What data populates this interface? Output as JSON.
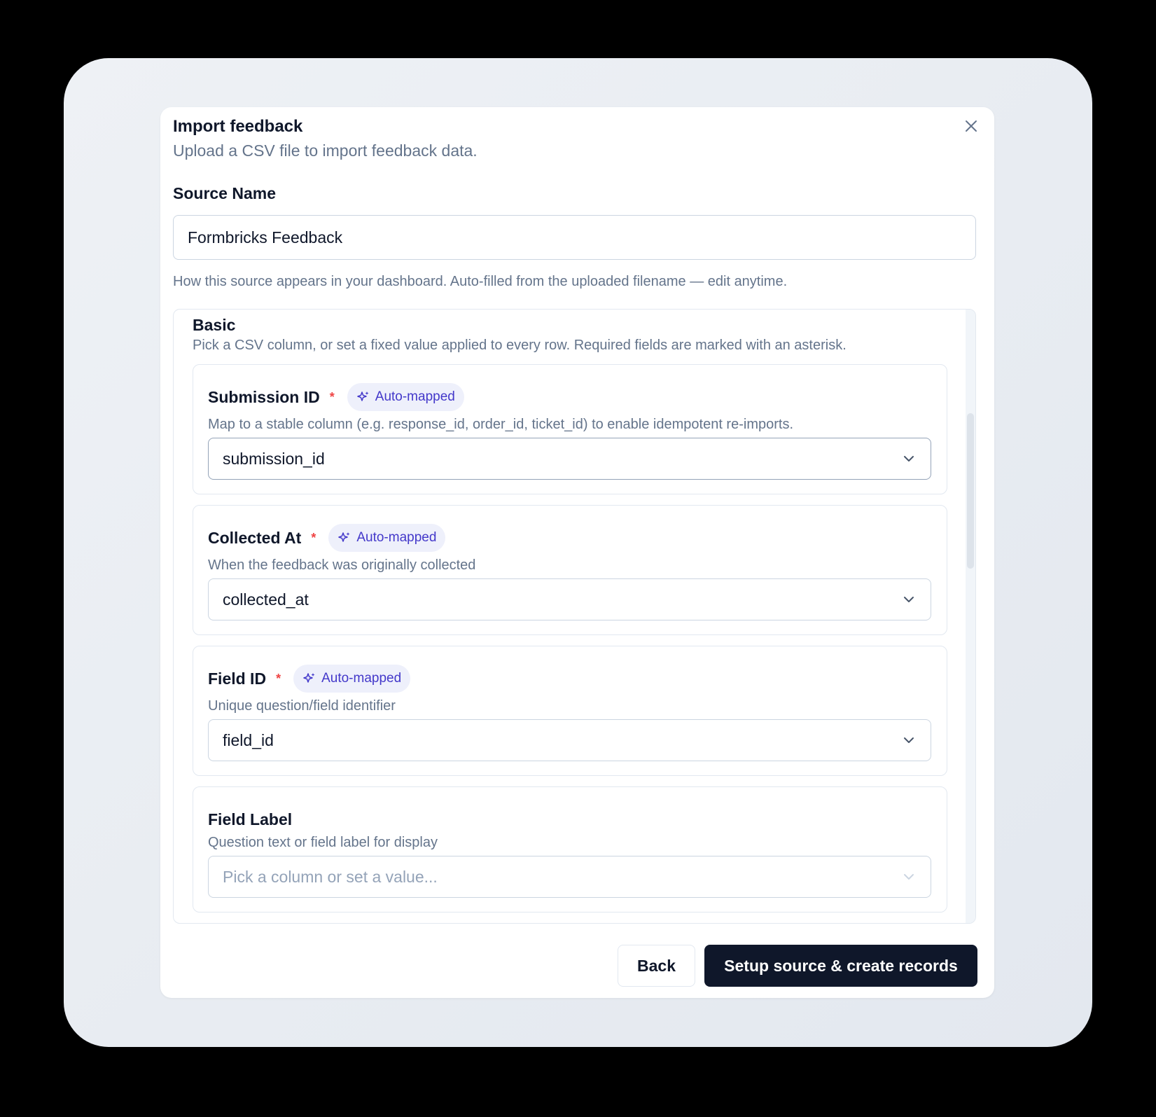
{
  "dialog": {
    "title": "Import feedback",
    "subtitle": "Upload a CSV file to import feedback data."
  },
  "source": {
    "label": "Source Name",
    "value": "Formbricks Feedback",
    "help": "How this source appears in your dashboard. Auto-filled from the uploaded filename — edit anytime."
  },
  "basic": {
    "title": "Basic",
    "description": "Pick a CSV column, or set a fixed value applied to every row. Required fields are marked with an asterisk.",
    "fields": [
      {
        "title": "Submission ID",
        "required_marker": "*",
        "badge": "Auto-mapped",
        "description": "Map to a stable column (e.g. response_id, order_id, ticket_id) to enable idempotent re-imports.",
        "value": "submission_id"
      },
      {
        "title": "Collected At",
        "required_marker": "*",
        "badge": "Auto-mapped",
        "description": "When the feedback was originally collected",
        "value": "collected_at"
      },
      {
        "title": "Field ID",
        "required_marker": "*",
        "badge": "Auto-mapped",
        "description": "Unique question/field identifier",
        "value": "field_id"
      },
      {
        "title": "Field Label",
        "description": "Question text or field label for display",
        "placeholder": "Pick a column or set a value..."
      }
    ]
  },
  "footer": {
    "back_label": "Back",
    "primary_label": "Setup source & create records"
  },
  "icons": {
    "close": "close-icon",
    "badge": "sparkles-icon",
    "select": "chevron-down-icon"
  },
  "colors": {
    "primary": "#0f172a",
    "badge_text": "#4338ca",
    "badge_bg": "#eef0fb",
    "required": "#ef4444",
    "muted_text": "#64748b"
  }
}
